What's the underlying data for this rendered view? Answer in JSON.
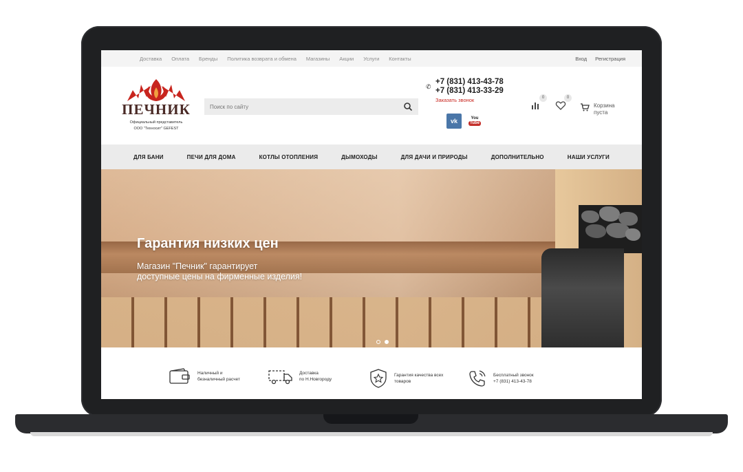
{
  "colors": {
    "brand_red": "#c8251e",
    "logo_dark": "#4a2a26",
    "nav_bg": "#ebebeb",
    "topbar_bg": "#f4f4f4",
    "vk_blue": "#4a76a8",
    "youtube_red": "#c4302b"
  },
  "topbar": {
    "links": [
      "Доставка",
      "Оплата",
      "Бренды",
      "Политика возврата и обмена",
      "Магазины",
      "Акции",
      "Услуги",
      "Контакты"
    ],
    "login": "Вход",
    "register": "Регистрация"
  },
  "logo": {
    "name": "ПЕЧНИК",
    "subtitle_line1": "Официальный представитель",
    "subtitle_line2": "ООО \"Техносит\" GEFEST"
  },
  "search": {
    "placeholder": "Поиск по сайту",
    "icon": "search-icon"
  },
  "contacts": {
    "phone1": "+7 (831) 413-43-78",
    "phone2": "+7 (831) 413-33-29",
    "callback": "Заказать звонок"
  },
  "social": {
    "vk": "vk",
    "youtube_top": "You",
    "youtube_bottom": "Tube"
  },
  "header_icons": {
    "compare_count": "0",
    "favorites_count": "0",
    "cart_line1": "Корзина",
    "cart_line2": "пуста"
  },
  "mainnav": [
    "ДЛЯ БАНИ",
    "ПЕЧИ ДЛЯ ДОМА",
    "КОТЛЫ ОТОПЛЕНИЯ",
    "ДЫМОХОДЫ",
    "ДЛЯ ДАЧИ И ПРИРОДЫ",
    "ДОПОЛНИТЕЛЬНО",
    "НАШИ УСЛУГИ"
  ],
  "hero": {
    "title": "Гарантия низких цен",
    "text_line1": "Магазин \"Печник\" гарантирует",
    "text_line2": "доступные цены на фирменные изделия!",
    "slides_total": 2,
    "slide_active": 2
  },
  "features": [
    {
      "icon": "wallet-icon",
      "line1": "Наличный и",
      "line2": "безналичный расчет"
    },
    {
      "icon": "truck-icon",
      "line1": "Доставка",
      "line2": "по Н.Новгороду"
    },
    {
      "icon": "quality-star-icon",
      "line1": "Гарантия качества всех",
      "line2": "товаров"
    },
    {
      "icon": "phone-call-icon",
      "line1": "Бесплатный звонок",
      "line2": "+7 (831) 413-43-78"
    }
  ]
}
